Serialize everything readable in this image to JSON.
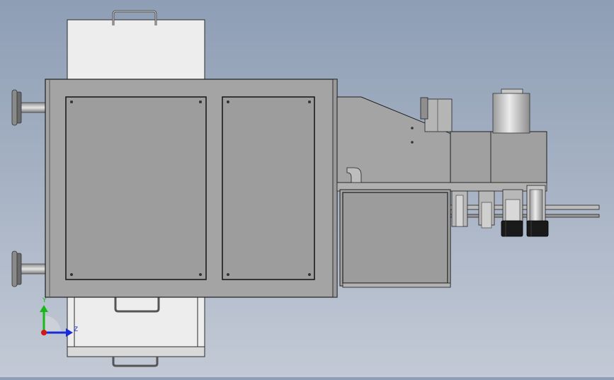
{
  "viewport": {
    "background_top": "#8e9eb5",
    "background_bottom": "#c3cad6"
  },
  "colors": {
    "body_metal": "#a4a4a4",
    "panel_metal": "#9d9d9d",
    "drawer_white": "#ededed",
    "cylinder_light": "#d8d8d8",
    "dark_part": "#1a1a1a",
    "outline": "#1e1e1e"
  },
  "triad": {
    "y_label": "Y",
    "z_label": "Z",
    "y_color": "#18b818",
    "z_color": "#1a2ad6",
    "x_color": "#d01818"
  },
  "icons": [
    "leveling-foot-icon",
    "drawer-handle-icon",
    "panel-screw-icon",
    "motor-cylinder-icon",
    "axis-triad-icon"
  ]
}
